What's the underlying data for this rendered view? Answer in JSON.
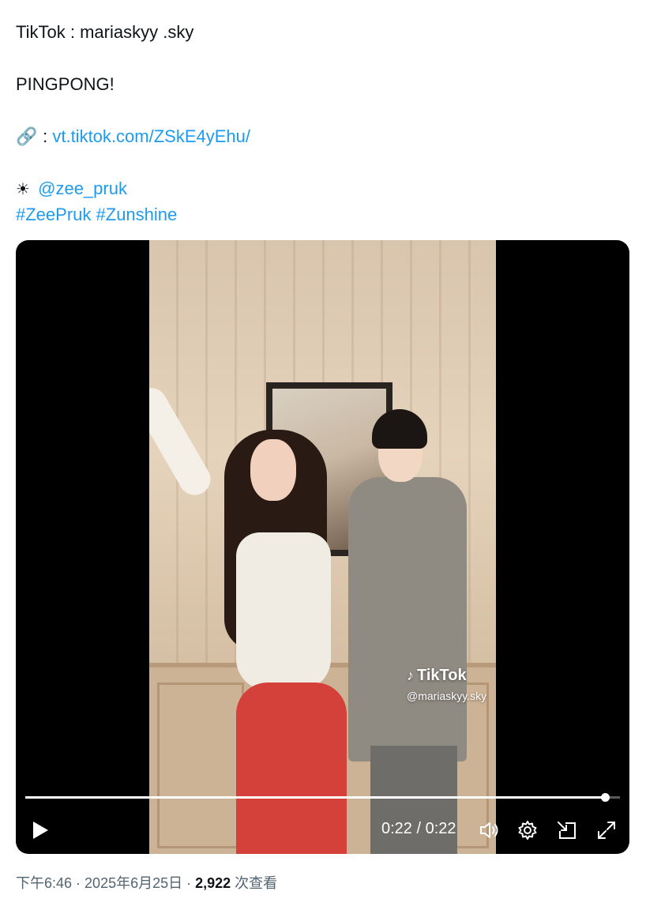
{
  "tweet": {
    "line1": "TikTok : mariaskyy .sky",
    "line2": "PINGPONG!",
    "link_emoji": "🔗",
    "link_prefix": " : ",
    "link_text": "vt.tiktok.com/ZSkE4yEhu/",
    "sun_emoji": "☀",
    "mention": "@zee_pruk",
    "hashtag1": "#ZeePruk",
    "hashtag2": "#Zunshine"
  },
  "video": {
    "watermark_brand": "TikTok",
    "watermark_user": "@mariaskyy.sky",
    "time_display": "0:22 / 0:22",
    "progress": 0.975,
    "icons": {
      "play": "play-icon",
      "volume": "volume-icon",
      "settings": "gear-icon",
      "pip": "picture-in-picture-icon",
      "fullscreen": "fullscreen-icon"
    }
  },
  "meta": {
    "time": "下午6:46",
    "sep1": " · ",
    "date": "2025年6月25日",
    "sep2": " · ",
    "views": "2,922",
    "views_label": " 次查看"
  },
  "colors": {
    "link": "#1d9bf0",
    "text": "#0f1419",
    "muted": "#536471"
  }
}
